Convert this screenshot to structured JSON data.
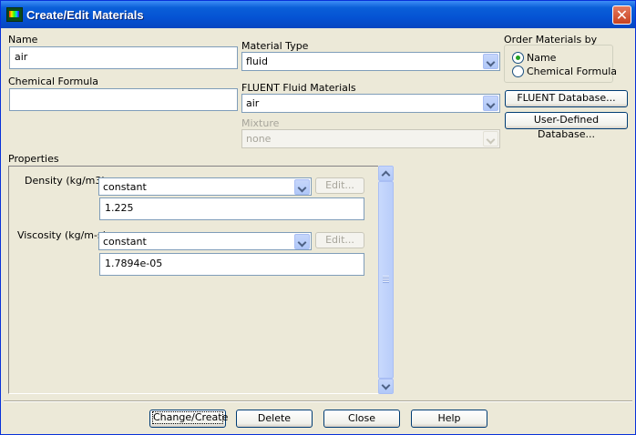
{
  "window": {
    "title": "Create/Edit Materials"
  },
  "name": {
    "label": "Name",
    "value": "air"
  },
  "chemical_formula": {
    "label": "Chemical Formula",
    "value": ""
  },
  "material_type": {
    "label": "Material Type",
    "value": "fluid"
  },
  "fluent_fluid_materials": {
    "label": "FLUENT Fluid Materials",
    "value": "air"
  },
  "mixture": {
    "label": "Mixture",
    "value": "none",
    "enabled": false
  },
  "order_by": {
    "label": "Order Materials by",
    "options": [
      {
        "label": "Name",
        "checked": true
      },
      {
        "label": "Chemical Formula",
        "checked": false
      }
    ]
  },
  "database_buttons": {
    "fluent": "FLUENT Database...",
    "user_defined": "User-Defined Database..."
  },
  "properties": {
    "label": "Properties",
    "rows": [
      {
        "label": "Density (kg/m3)",
        "method": "constant",
        "edit": "Edit...",
        "value": "1.225"
      },
      {
        "label": "Viscosity (kg/m-s)",
        "method": "constant",
        "edit": "Edit...",
        "value": "1.7894e-05"
      }
    ]
  },
  "footer": {
    "change_create": "Change/Create",
    "delete": "Delete",
    "close": "Close",
    "help": "Help"
  }
}
